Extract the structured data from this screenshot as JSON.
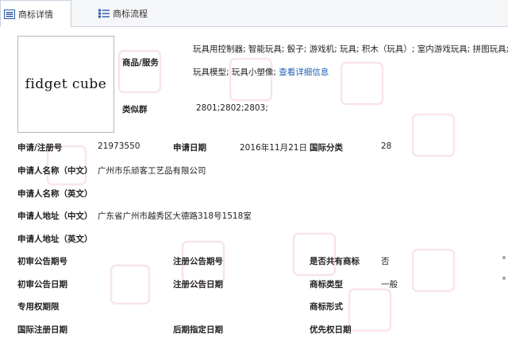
{
  "tabs": [
    {
      "label": "商标详情",
      "active": true
    },
    {
      "label": "商标流程",
      "active": false
    }
  ],
  "logo": {
    "text": "fidget cube"
  },
  "goods": {
    "label": "商品/服务",
    "line1": "玩具用控制器; 智能玩具; 骰子; 游戏机; 玩具; 积木（玩具）; 室内游戏玩具; 拼图玩具;",
    "line2_prefix": "玩具模型; 玩具小塑像;",
    "link": "查看详细信息"
  },
  "similar": {
    "label": "类似群",
    "value": "2801;2802;2803;"
  },
  "rows": {
    "reg_no_label": "申请/注册号",
    "reg_no": "21973550",
    "apply_date_label": "申请日期",
    "apply_date": "2016年11月21日",
    "intl_class_label": "国际分类",
    "intl_class": "28",
    "applicant_cn_label": "申请人名称（中文）",
    "applicant_cn": "广州市乐顽客工艺品有限公司",
    "applicant_en_label": "申请人名称（英文）",
    "applicant_en": "",
    "address_cn_label": "申请人地址（中文）",
    "address_cn": "广东省广州市越秀区大德路318号1518室",
    "address_en_label": "申请人地址（英文）",
    "address_en": "",
    "prelim_no_label": "初审公告期号",
    "prelim_no": "",
    "reg_notice_no_label": "注册公告期号",
    "reg_notice_no": "",
    "shared_label": "是否共有商标",
    "shared": "否",
    "prelim_date_label": "初审公告日期",
    "prelim_date": "",
    "reg_notice_date_label": "注册公告日期",
    "reg_notice_date": "",
    "tm_type_label": "商标类型",
    "tm_type": "一般",
    "exclusive_label": "专用权期限",
    "exclusive": "",
    "tm_form_label": "商标形式",
    "tm_form": "",
    "intl_reg_date_label": "国际注册日期",
    "intl_reg_date": "",
    "later_date_label": "后期指定日期",
    "later_date": "",
    "priority_date_label": "优先权日期",
    "priority_date": ""
  },
  "colors": {
    "link": "#1a5fb4",
    "tab_border": "#c9d3e0",
    "watermark": "#e06a7a"
  }
}
